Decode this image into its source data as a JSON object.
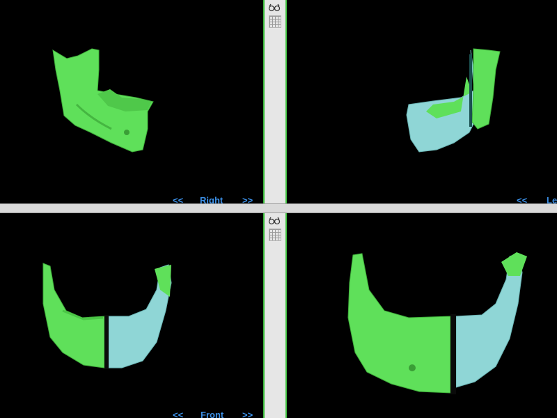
{
  "viewports": {
    "top_left": {
      "prev": "<<",
      "label": "Right",
      "next": ">>"
    },
    "top_right": {
      "prev": "<<",
      "label": "Le",
      "next": ""
    },
    "bottom_left": {
      "prev": "<<",
      "label": "Front",
      "next": ">>"
    }
  },
  "toolbar": {
    "view_icon": "glasses-icon",
    "grid_icon": "grid-icon"
  },
  "colors": {
    "bone_green": "#5fe05a",
    "bone_blue": "#8fd6d6",
    "nav_text": "#3b8fe6",
    "background": "#000000"
  }
}
